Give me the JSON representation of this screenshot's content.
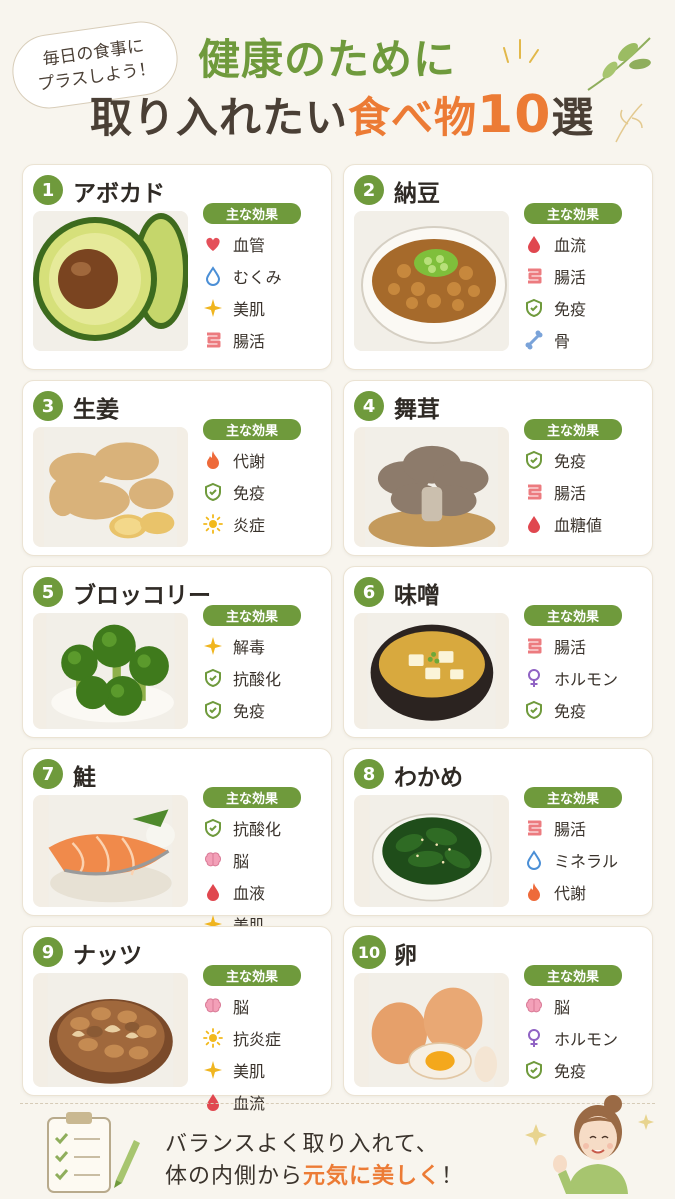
{
  "header": {
    "bubble_line1": "毎日の食事に",
    "bubble_line2": "プラスしよう！",
    "title_line1": "健康のために",
    "title_line2_a": "取り入れたい",
    "title_line2_b": "食べ物",
    "title_line2_num": "10",
    "title_line2_c": "選"
  },
  "effects_label": "主な効果",
  "foods": [
    {
      "num": "1",
      "name": "アボカド",
      "effects": [
        {
          "icon": "heart-icon",
          "label": "血管"
        },
        {
          "icon": "water-drop-icon",
          "label": "むくみ"
        },
        {
          "icon": "sparkle-icon",
          "label": "美肌"
        },
        {
          "icon": "intestine-icon",
          "label": "腸活"
        }
      ]
    },
    {
      "num": "2",
      "name": "納豆",
      "effects": [
        {
          "icon": "blood-drop-icon",
          "label": "血流"
        },
        {
          "icon": "intestine-icon",
          "label": "腸活"
        },
        {
          "icon": "shield-icon",
          "label": "免疫"
        },
        {
          "icon": "bone-icon",
          "label": "骨"
        }
      ]
    },
    {
      "num": "3",
      "name": "生姜",
      "effects": [
        {
          "icon": "flame-icon",
          "label": "代謝"
        },
        {
          "icon": "shield-icon",
          "label": "免疫"
        },
        {
          "icon": "sun-icon",
          "label": "炎症"
        }
      ]
    },
    {
      "num": "4",
      "name": "舞茸",
      "effects": [
        {
          "icon": "shield-icon",
          "label": "免疫"
        },
        {
          "icon": "intestine-icon",
          "label": "腸活"
        },
        {
          "icon": "blood-drop-icon",
          "label": "血糖値"
        }
      ]
    },
    {
      "num": "5",
      "name": "ブロッコリー",
      "effects": [
        {
          "icon": "sparkle-icon",
          "label": "解毒"
        },
        {
          "icon": "shield-icon",
          "label": "抗酸化"
        },
        {
          "icon": "shield-icon",
          "label": "免疫"
        }
      ]
    },
    {
      "num": "6",
      "name": "味噌",
      "effects": [
        {
          "icon": "intestine-icon",
          "label": "腸活"
        },
        {
          "icon": "female-icon",
          "label": "ホルモン"
        },
        {
          "icon": "shield-icon",
          "label": "免疫"
        }
      ]
    },
    {
      "num": "7",
      "name": "鮭",
      "effects": [
        {
          "icon": "shield-icon",
          "label": "抗酸化"
        },
        {
          "icon": "brain-icon",
          "label": "脳"
        },
        {
          "icon": "blood-drop-icon",
          "label": "血液"
        },
        {
          "icon": "sparkle-icon",
          "label": "美肌"
        }
      ]
    },
    {
      "num": "8",
      "name": "わかめ",
      "effects": [
        {
          "icon": "intestine-icon",
          "label": "腸活"
        },
        {
          "icon": "water-drop-icon",
          "label": "ミネラル"
        },
        {
          "icon": "flame-icon",
          "label": "代謝"
        }
      ]
    },
    {
      "num": "9",
      "name": "ナッツ",
      "effects": [
        {
          "icon": "brain-icon",
          "label": "脳"
        },
        {
          "icon": "sun-icon",
          "label": "抗炎症"
        },
        {
          "icon": "sparkle-icon",
          "label": "美肌"
        },
        {
          "icon": "blood-drop-icon",
          "label": "血流"
        }
      ]
    },
    {
      "num": "10",
      "name": "卵",
      "effects": [
        {
          "icon": "brain-icon",
          "label": "脳"
        },
        {
          "icon": "female-icon",
          "label": "ホルモン"
        },
        {
          "icon": "shield-icon",
          "label": "免疫"
        }
      ]
    }
  ],
  "footer": {
    "line1": "バランスよく取り入れて、",
    "line2_a": "体の内側から",
    "line2_b": "元気に美しく",
    "line2_c": "！"
  },
  "colors": {
    "accent_green": "#6f9a3c",
    "accent_orange": "#ec7b35",
    "background": "#f8f5ee"
  }
}
